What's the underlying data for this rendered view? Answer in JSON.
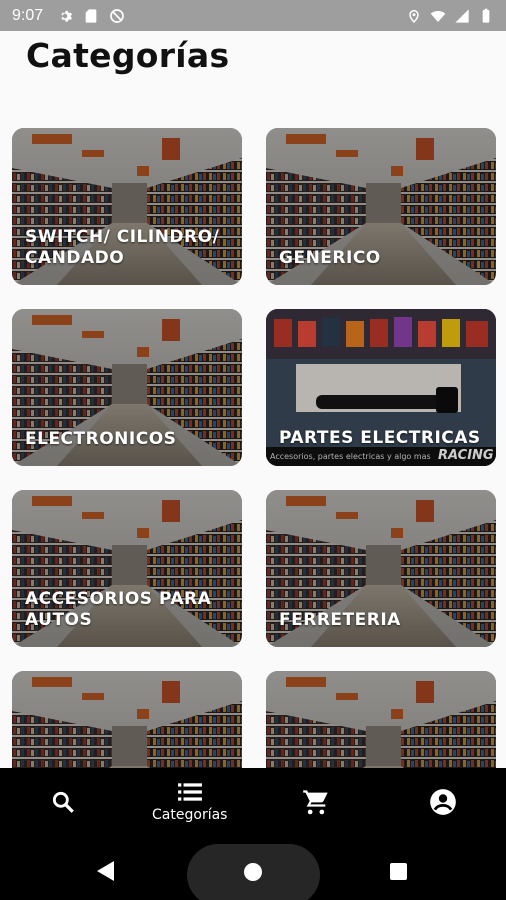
{
  "status_bar": {
    "time": "9:07",
    "left_icons": [
      "gear-icon",
      "sd-card-icon",
      "do-not-disturb-icon"
    ],
    "right_icons": [
      "location-icon",
      "wifi-icon",
      "signal-icon",
      "battery-icon"
    ]
  },
  "page": {
    "title": "Categorías"
  },
  "categories": [
    {
      "label": "SWITCH/ CILINDRO/ CANDADO",
      "image": "store-aisle"
    },
    {
      "label": "GENERICO",
      "image": "store-aisle"
    },
    {
      "label": "ELECTRONICOS",
      "image": "store-aisle"
    },
    {
      "label": "PARTES ELECTRICAS",
      "image": "ignition-coil-product",
      "image_caption": "Accesorios, partes electricas y algo mas",
      "image_logo": "RACING"
    },
    {
      "label": "ACCESORIOS PARA AUTOS",
      "image": "store-aisle"
    },
    {
      "label": "FERRETERIA",
      "image": "store-aisle"
    },
    {
      "label": "",
      "image": "store-aisle"
    },
    {
      "label": "",
      "image": "store-aisle"
    }
  ],
  "bottom_nav": {
    "items": [
      {
        "icon": "search-icon",
        "label": ""
      },
      {
        "icon": "list-icon",
        "label": "Categorías"
      },
      {
        "icon": "cart-icon",
        "label": ""
      },
      {
        "icon": "account-icon",
        "label": ""
      }
    ],
    "active": 1
  },
  "colors": {
    "status_bar": "#9e9e9e",
    "nav_bar": "#000000",
    "background": "#fafafa"
  }
}
